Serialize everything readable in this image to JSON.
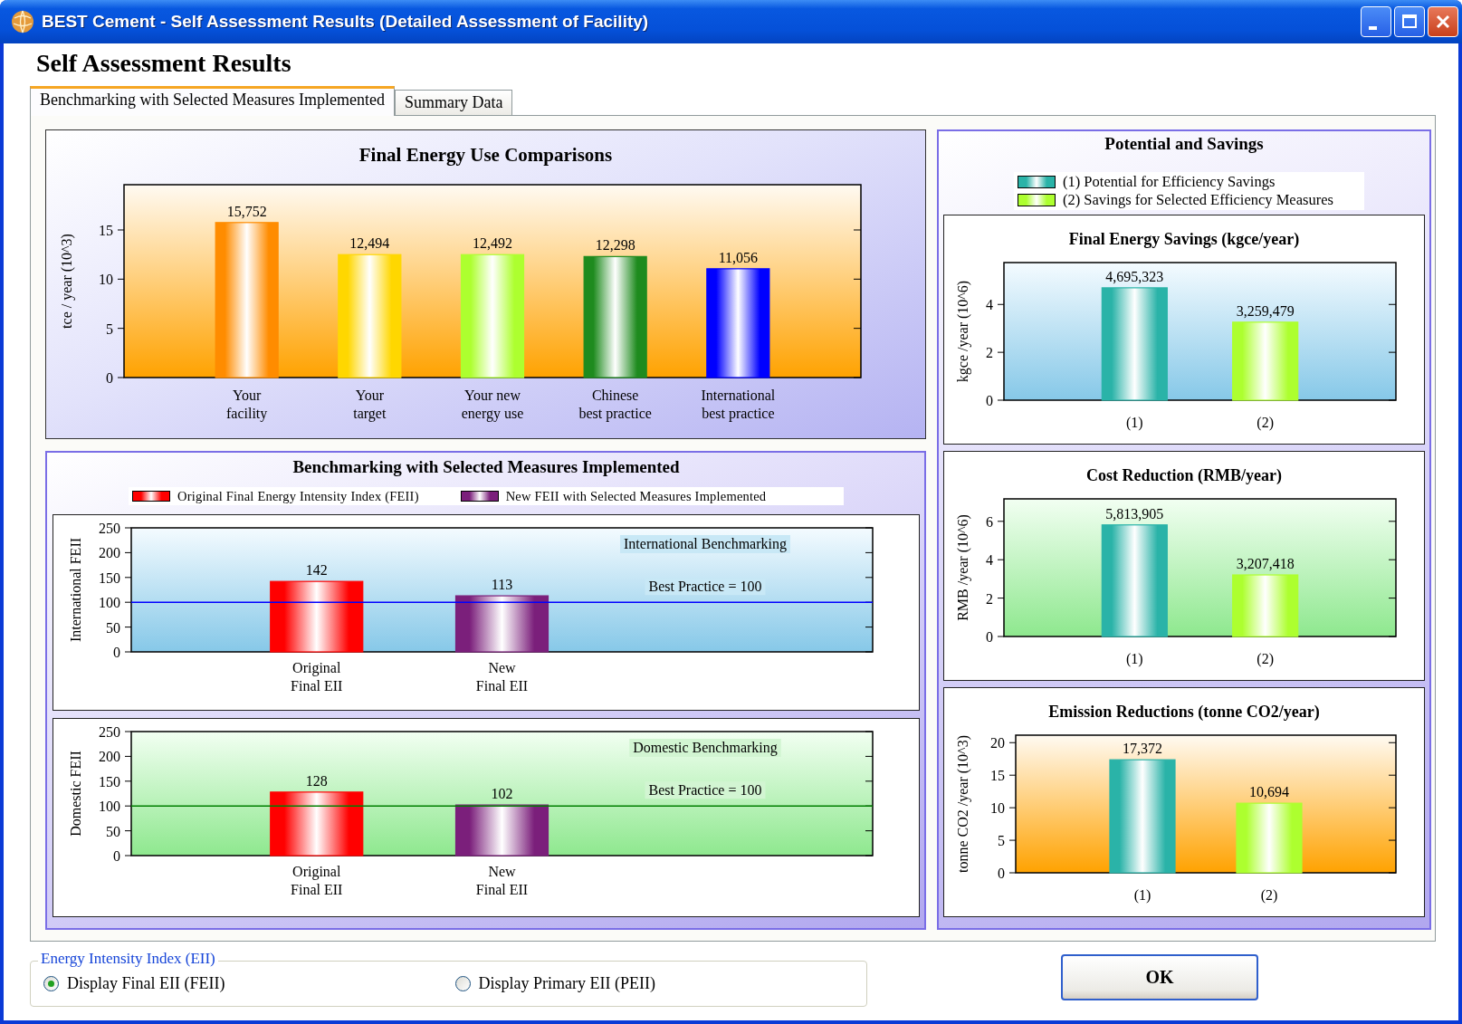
{
  "window": {
    "title": "BEST Cement - Self Assessment Results (Detailed Assessment of Facility)"
  },
  "heading": "Self Assessment Results",
  "tabs": [
    {
      "label": "Benchmarking with Selected Measures Implemented",
      "selected": true
    },
    {
      "label": "Summary Data",
      "selected": false
    }
  ],
  "energy_use_panel": {
    "chart_data": {
      "type": "bar",
      "title": "Final Energy Use Comparisons",
      "ylabel": "tce / year (10^3)",
      "categories": [
        "Your\nfacility",
        "Your\ntarget",
        "Your new\nenergy use",
        "Chinese\nbest practice",
        "International\nbest practice"
      ],
      "values": [
        15.752,
        12.494,
        12.492,
        12.298,
        11.056
      ],
      "annotations": [
        "15,752",
        "12,494",
        "12,492",
        "12,298",
        "11,056"
      ],
      "colors": [
        "#ff8c00",
        "#ffd700",
        "#adff2f",
        "#1e8b1e",
        "#0000ff"
      ],
      "ylim": [
        0,
        19.6
      ],
      "yticks": [
        0,
        5,
        10,
        15
      ]
    }
  },
  "benchmarking_panel": {
    "title": "Benchmarking with Selected Measures Implemented",
    "legend": [
      {
        "label": "Original Final Energy Intensity Index (FEII)",
        "color": "#ff0000"
      },
      {
        "label": "New FEII with Selected Measures Implemented",
        "color": "#7b1f7b"
      }
    ],
    "charts": [
      {
        "chart_data": {
          "type": "bar",
          "ylabel": "International FEII",
          "categories": [
            "Original\nFinal EII",
            "New\nFinal EII"
          ],
          "values": [
            142,
            113
          ],
          "data_labels": true,
          "colors": [
            "#ff0000",
            "#7b1f7b"
          ],
          "ylim": [
            0,
            250
          ],
          "yticks": [
            0,
            50,
            100,
            150,
            200,
            250
          ],
          "annotations": [
            "International Benchmarking"
          ],
          "ref_lines": [
            {
              "axis": "y",
              "value": 100,
              "label": "Best Practice = 100",
              "color": "#0000ff"
            }
          ]
        }
      },
      {
        "chart_data": {
          "type": "bar",
          "ylabel": "Domestic FEII",
          "categories": [
            "Original\nFinal EII",
            "New\nFinal EII"
          ],
          "values": [
            128,
            102
          ],
          "data_labels": true,
          "colors": [
            "#ff0000",
            "#7b1f7b"
          ],
          "ylim": [
            0,
            250
          ],
          "yticks": [
            0,
            50,
            100,
            150,
            200,
            250
          ],
          "annotations": [
            "Domestic Benchmarking"
          ],
          "ref_lines": [
            {
              "axis": "y",
              "value": 100,
              "label": "Best Practice = 100",
              "color": "#008000"
            }
          ]
        }
      }
    ]
  },
  "savings_panel": {
    "title": "Potential and Savings",
    "legend": [
      {
        "label": "(1) Potential for Efficiency Savings",
        "color": "#2ab3a8"
      },
      {
        "label": "(2) Savings for Selected Efficiency Measures",
        "color": "#adff2f"
      }
    ],
    "charts": [
      {
        "chart_data": {
          "type": "bar",
          "title": "Final Energy Savings (kgce/year)",
          "ylabel": "kgce /year (10^6)",
          "categories": [
            "(1)",
            "(2)"
          ],
          "values": [
            4.695323,
            3.259479
          ],
          "annotations": [
            "4,695,323",
            "3,259,479"
          ],
          "colors": [
            "#2ab3a8",
            "#adff2f"
          ],
          "ylim": [
            0,
            5.75
          ],
          "yticks": [
            0,
            2,
            4
          ]
        }
      },
      {
        "chart_data": {
          "type": "bar",
          "title": "Cost Reduction (RMB/year)",
          "ylabel": "RMB /year (10^6)",
          "categories": [
            "(1)",
            "(2)"
          ],
          "values": [
            5.813905,
            3.207418
          ],
          "annotations": [
            "5,813,905",
            "3,207,418"
          ],
          "colors": [
            "#2ab3a8",
            "#adff2f"
          ],
          "ylim": [
            0,
            7.17
          ],
          "yticks": [
            0,
            2,
            4,
            6
          ]
        }
      },
      {
        "chart_data": {
          "type": "bar",
          "title": "Emission Reductions (tonne CO2/year)",
          "ylabel": "tonne CO2 /year (10^3)",
          "categories": [
            "(1)",
            "(2)"
          ],
          "values": [
            17.372,
            10.694
          ],
          "annotations": [
            "17,372",
            "10,694"
          ],
          "colors": [
            "#2ab3a8",
            "#adff2f"
          ],
          "ylim": [
            0,
            21.15
          ],
          "yticks": [
            0,
            5,
            10,
            15,
            20
          ]
        }
      }
    ]
  },
  "eii_group": {
    "title": "Energy Intensity Index (EII)",
    "options": [
      {
        "label": "Display Final EII (FEII)",
        "selected": true
      },
      {
        "label": "Display Primary EII (PEII)",
        "selected": false
      }
    ]
  },
  "buttons": [
    "OK"
  ]
}
